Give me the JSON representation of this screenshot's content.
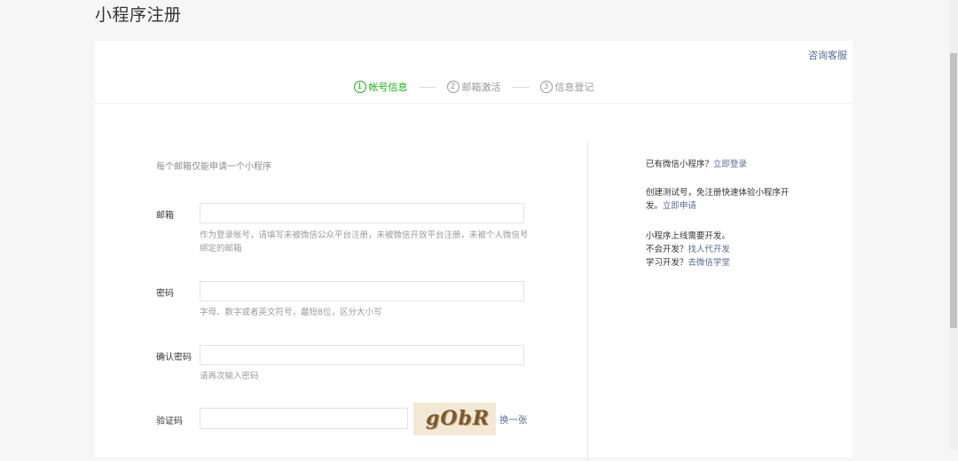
{
  "page": {
    "title": "小程序注册"
  },
  "header": {
    "service_link": "咨询客服"
  },
  "steps": [
    {
      "num": "1",
      "label": "帐号信息",
      "active": true
    },
    {
      "num": "2",
      "label": "邮箱激活",
      "active": false
    },
    {
      "num": "3",
      "label": "信息登记",
      "active": false
    }
  ],
  "form": {
    "intro": "每个邮箱仅能申请一个小程序",
    "email": {
      "label": "邮箱",
      "value": "",
      "tip": "作为登录帐号，请填写未被微信公众平台注册，未被微信开放平台注册，未被个人微信号绑定的邮箱"
    },
    "password": {
      "label": "密码",
      "value": "",
      "tip": "字母、数字或者英文符号，最短8位，区分大小写"
    },
    "confirm_password": {
      "label": "确认密码",
      "value": "",
      "tip": "请再次输入密码"
    },
    "captcha": {
      "label": "验证码",
      "value": "",
      "image_text": "gObR",
      "refresh_label": "换一张"
    }
  },
  "sidebar": {
    "login": {
      "text": "已有微信小程序？",
      "link": "立即登录"
    },
    "test": {
      "text": "创建测试号，免注册快速体验小程序开发。",
      "link": "立即申请"
    },
    "dev": {
      "line1": "小程序上线需要开发。",
      "line2_text": "不会开发？",
      "line2_link": "找人代开发",
      "line3_text": "学习开发？",
      "line3_link": "去微信学堂"
    }
  },
  "colors": {
    "accent": "#1aad19",
    "link": "#576b95"
  }
}
